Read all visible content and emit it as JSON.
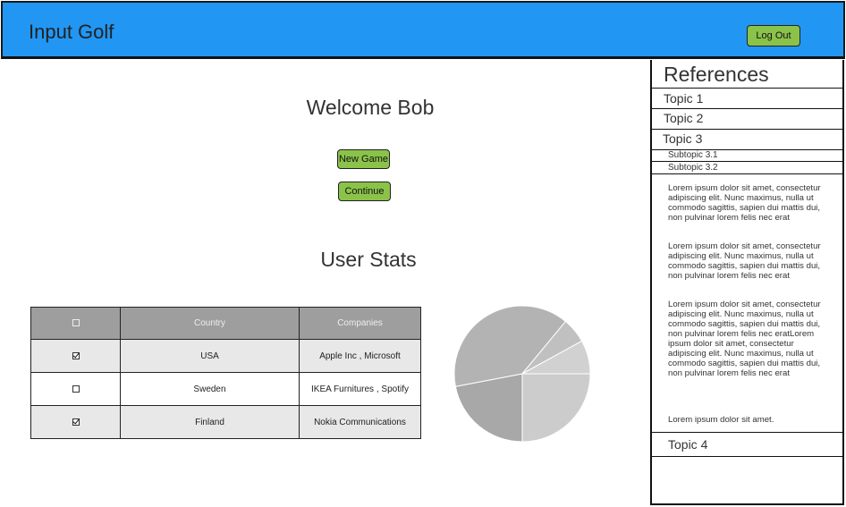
{
  "header": {
    "title": "Input Golf",
    "logout_label": "Log Out",
    "bg_color": "#2196f3"
  },
  "main": {
    "welcome": "Welcome Bob",
    "new_game_label": "New Game",
    "continue_label": "Continue",
    "stats_title": "User Stats"
  },
  "table": {
    "headers": [
      "",
      "Country",
      "Companies"
    ],
    "rows": [
      {
        "checked": true,
        "country": "USA",
        "companies": "Apple Inc , Microsoft"
      },
      {
        "checked": false,
        "country": "Sweden",
        "companies": "IKEA Furnitures , Spotify"
      },
      {
        "checked": true,
        "country": "Finland",
        "companies": "Nokia Communications"
      }
    ]
  },
  "pie_chart": {
    "slices": [
      {
        "value": 25,
        "color": "#cccccc"
      },
      {
        "value": 22,
        "color": "#a8a8a8"
      },
      {
        "value": 39,
        "color": "#b3b3b3"
      },
      {
        "value": 6,
        "color": "#c0c0c0"
      },
      {
        "value": 8,
        "color": "#d1d1d1"
      }
    ]
  },
  "sidebar": {
    "title": "References",
    "topic1": "Topic 1",
    "topic2": "Topic 2",
    "topic3": "Topic 3",
    "subtopic31": "Subtopic 3.1",
    "subtopic32": "Subtopic 3.2",
    "lorem1": "Lorem ipsum dolor sit amet, consectetur adipiscing elit. Nunc maximus, nulla ut commodo sagittis, sapien dui mattis dui, non pulvinar lorem felis nec erat",
    "lorem2": "Lorem ipsum dolor sit amet, consectetur adipiscing elit. Nunc maximus, nulla ut commodo sagittis, sapien dui mattis dui, non pulvinar lorem felis nec erat",
    "lorem3": "Lorem ipsum dolor sit amet, consectetur adipiscing elit. Nunc maximus, nulla ut commodo sagittis, sapien dui mattis dui, non pulvinar lorem felis nec eratLorem ipsum dolor sit amet, consectetur adipiscing elit. Nunc maximus, nulla ut commodo sagittis, sapien dui mattis dui, non pulvinar lorem felis nec erat",
    "lorem4": "Lorem ipsum dolor sit amet.",
    "topic4": "Topic 4"
  }
}
